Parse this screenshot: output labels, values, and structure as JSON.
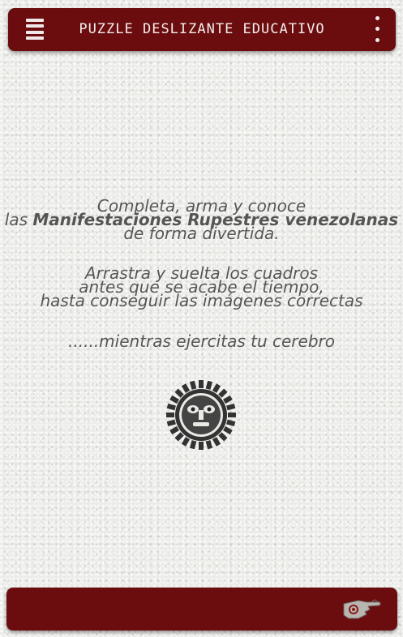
{
  "app": {
    "title": "PUZZLE DESLIZANTE EDUCATIVO"
  },
  "intro": {
    "line1": "Completa, arma y conoce",
    "line2_prefix": "las ",
    "line2_bold": "Manifestaciones Rupestres venezolanas",
    "line3": "de forma divertida."
  },
  "instructions": {
    "line1": "Arrastra y suelta los cuadros",
    "line2": "antes que se acabe el tiempo,",
    "line3": "hasta conseguir las imágenes correctas"
  },
  "tagline": "......mientras ejercitas tu cerebro",
  "icons": {
    "menu": "hamburger-menu-icon",
    "overflow": "more-vertical-icon",
    "logo": "petroglyph-sun-face-icon",
    "next": "pointing-hand-icon"
  },
  "colors": {
    "bar": "#6b0d0f",
    "bar_text": "#f4ecec",
    "body_text": "#555555",
    "background": "#ebebe8"
  }
}
